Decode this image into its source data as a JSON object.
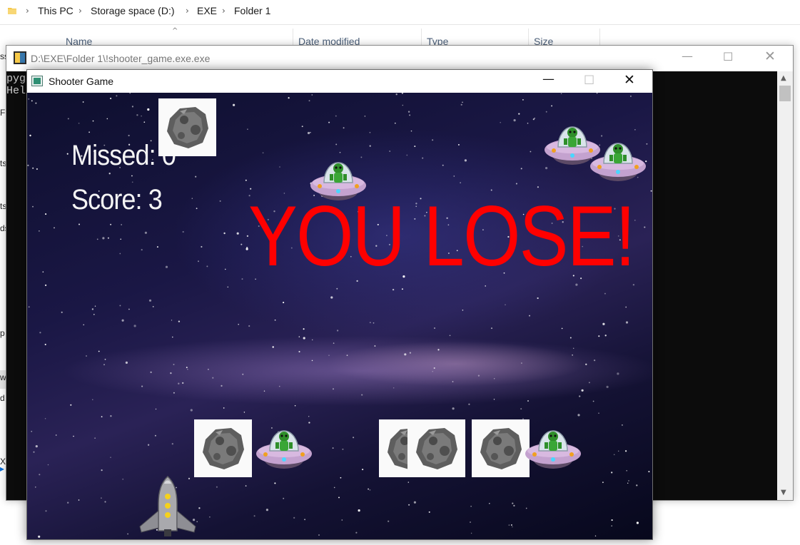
{
  "explorer": {
    "breadcrumb": [
      "This PC",
      "Storage space (D:)",
      "EXE",
      "Folder 1"
    ],
    "columns": [
      "Name",
      "Date modified",
      "Type",
      "Size"
    ],
    "left_fragments": [
      "ss",
      "F",
      "ts",
      "ts",
      "ds",
      "p",
      "w",
      "d",
      "X"
    ]
  },
  "console": {
    "title": "D:\\EXE\\Folder 1\\!shooter_game.exe.exe",
    "lines": [
      "pyga",
      "Hel"
    ]
  },
  "game_window": {
    "title": "Shooter Game",
    "missed_label": "Missed: 0",
    "score_label": "Score: 3",
    "message": "YOU LOSE!",
    "message_color": "#ff0000"
  },
  "sprites": {
    "asteroid_icon": "asteroid-icon",
    "ufo_icon": "ufo-icon",
    "rocket_icon": "rocket-icon"
  },
  "colors": {
    "console_bg": "#0c0c0c",
    "hud_text": "#f4f4f4"
  }
}
